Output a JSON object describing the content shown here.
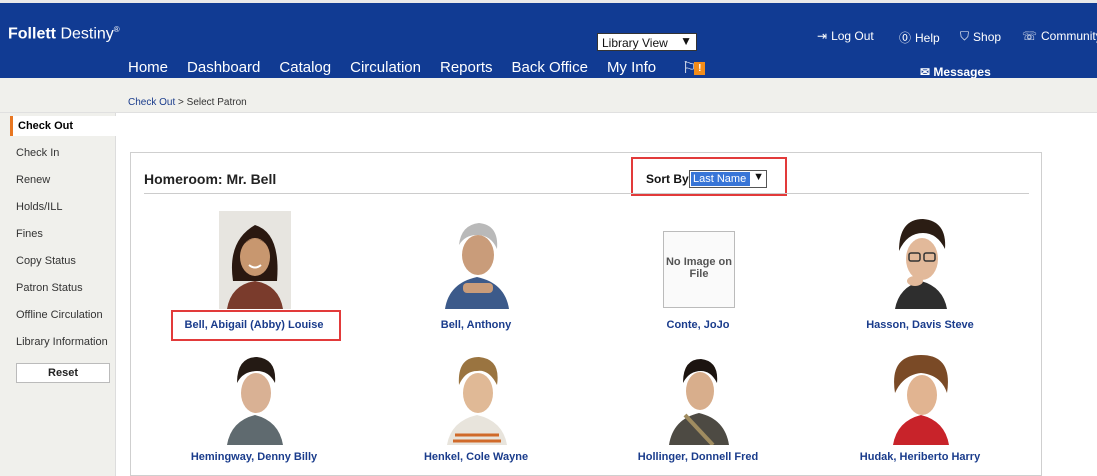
{
  "header": {
    "logo_bold": "Follett",
    "logo_rest": " Destiny",
    "logo_mark": "®",
    "view_selector": "Library View",
    "utilities": [
      "Log Out",
      "Help",
      "Shop",
      "Community"
    ],
    "nav": [
      "Home",
      "Dashboard",
      "Catalog",
      "Circulation",
      "Reports",
      "Back Office",
      "My Info"
    ],
    "active_nav": "Circulation",
    "alert_badge": "!",
    "messages": "Messages"
  },
  "breadcrumb": {
    "link": "Check Out",
    "separator": " > ",
    "current": "Select Patron"
  },
  "sidebar": {
    "items": [
      "Check Out",
      "Check In",
      "Renew",
      "Holds/ILL",
      "Fines",
      "Copy Status",
      "Patron Status",
      "Offline Circulation",
      "Library Information"
    ],
    "active": "Check Out",
    "reset": "Reset"
  },
  "main": {
    "homeroom": "Homeroom: Mr. Bell",
    "sort_label": "Sort By",
    "sort_value": "Last Name",
    "no_image_text": "No Image on File",
    "patrons": [
      {
        "name": "Bell, Abigail (Abby) Louise"
      },
      {
        "name": "Bell, Anthony"
      },
      {
        "name": "Conte, JoJo"
      },
      {
        "name": "Hasson, Davis Steve"
      },
      {
        "name": "Hemingway, Denny Billy"
      },
      {
        "name": "Henkel, Cole Wayne"
      },
      {
        "name": "Hollinger, Donnell Fred"
      },
      {
        "name": "Hudak, Heriberto Harry"
      }
    ]
  },
  "colors": {
    "header_blue": "#113b93",
    "accent_orange": "#f2a93b",
    "highlight_red": "#e23a3a",
    "link_blue": "#1a3c8c"
  }
}
